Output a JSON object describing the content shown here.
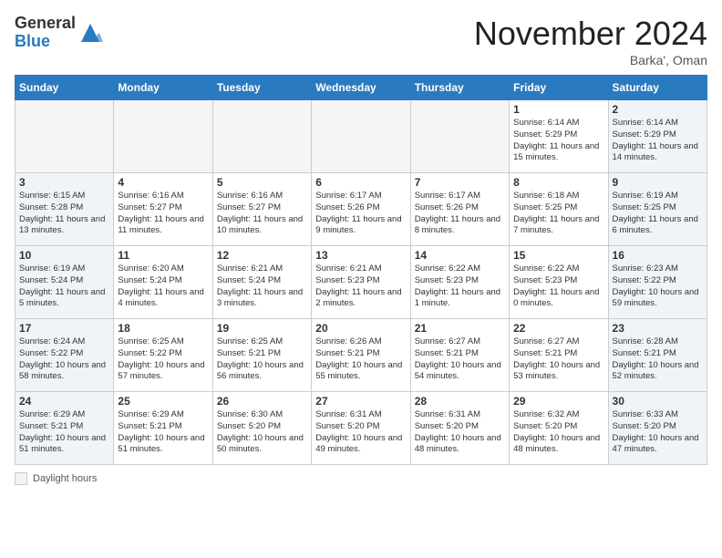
{
  "logo": {
    "general": "General",
    "blue": "Blue"
  },
  "title": "November 2024",
  "location": "Barka', Oman",
  "days_of_week": [
    "Sunday",
    "Monday",
    "Tuesday",
    "Wednesday",
    "Thursday",
    "Friday",
    "Saturday"
  ],
  "legend_label": "Daylight hours",
  "weeks": [
    [
      {
        "day": "",
        "info": ""
      },
      {
        "day": "",
        "info": ""
      },
      {
        "day": "",
        "info": ""
      },
      {
        "day": "",
        "info": ""
      },
      {
        "day": "",
        "info": ""
      },
      {
        "day": "1",
        "info": "Sunrise: 6:14 AM\nSunset: 5:29 PM\nDaylight: 11 hours and 15 minutes."
      },
      {
        "day": "2",
        "info": "Sunrise: 6:14 AM\nSunset: 5:29 PM\nDaylight: 11 hours and 14 minutes."
      }
    ],
    [
      {
        "day": "3",
        "info": "Sunrise: 6:15 AM\nSunset: 5:28 PM\nDaylight: 11 hours and 13 minutes."
      },
      {
        "day": "4",
        "info": "Sunrise: 6:16 AM\nSunset: 5:27 PM\nDaylight: 11 hours and 11 minutes."
      },
      {
        "day": "5",
        "info": "Sunrise: 6:16 AM\nSunset: 5:27 PM\nDaylight: 11 hours and 10 minutes."
      },
      {
        "day": "6",
        "info": "Sunrise: 6:17 AM\nSunset: 5:26 PM\nDaylight: 11 hours and 9 minutes."
      },
      {
        "day": "7",
        "info": "Sunrise: 6:17 AM\nSunset: 5:26 PM\nDaylight: 11 hours and 8 minutes."
      },
      {
        "day": "8",
        "info": "Sunrise: 6:18 AM\nSunset: 5:25 PM\nDaylight: 11 hours and 7 minutes."
      },
      {
        "day": "9",
        "info": "Sunrise: 6:19 AM\nSunset: 5:25 PM\nDaylight: 11 hours and 6 minutes."
      }
    ],
    [
      {
        "day": "10",
        "info": "Sunrise: 6:19 AM\nSunset: 5:24 PM\nDaylight: 11 hours and 5 minutes."
      },
      {
        "day": "11",
        "info": "Sunrise: 6:20 AM\nSunset: 5:24 PM\nDaylight: 11 hours and 4 minutes."
      },
      {
        "day": "12",
        "info": "Sunrise: 6:21 AM\nSunset: 5:24 PM\nDaylight: 11 hours and 3 minutes."
      },
      {
        "day": "13",
        "info": "Sunrise: 6:21 AM\nSunset: 5:23 PM\nDaylight: 11 hours and 2 minutes."
      },
      {
        "day": "14",
        "info": "Sunrise: 6:22 AM\nSunset: 5:23 PM\nDaylight: 11 hours and 1 minute."
      },
      {
        "day": "15",
        "info": "Sunrise: 6:22 AM\nSunset: 5:23 PM\nDaylight: 11 hours and 0 minutes."
      },
      {
        "day": "16",
        "info": "Sunrise: 6:23 AM\nSunset: 5:22 PM\nDaylight: 10 hours and 59 minutes."
      }
    ],
    [
      {
        "day": "17",
        "info": "Sunrise: 6:24 AM\nSunset: 5:22 PM\nDaylight: 10 hours and 58 minutes."
      },
      {
        "day": "18",
        "info": "Sunrise: 6:25 AM\nSunset: 5:22 PM\nDaylight: 10 hours and 57 minutes."
      },
      {
        "day": "19",
        "info": "Sunrise: 6:25 AM\nSunset: 5:21 PM\nDaylight: 10 hours and 56 minutes."
      },
      {
        "day": "20",
        "info": "Sunrise: 6:26 AM\nSunset: 5:21 PM\nDaylight: 10 hours and 55 minutes."
      },
      {
        "day": "21",
        "info": "Sunrise: 6:27 AM\nSunset: 5:21 PM\nDaylight: 10 hours and 54 minutes."
      },
      {
        "day": "22",
        "info": "Sunrise: 6:27 AM\nSunset: 5:21 PM\nDaylight: 10 hours and 53 minutes."
      },
      {
        "day": "23",
        "info": "Sunrise: 6:28 AM\nSunset: 5:21 PM\nDaylight: 10 hours and 52 minutes."
      }
    ],
    [
      {
        "day": "24",
        "info": "Sunrise: 6:29 AM\nSunset: 5:21 PM\nDaylight: 10 hours and 51 minutes."
      },
      {
        "day": "25",
        "info": "Sunrise: 6:29 AM\nSunset: 5:21 PM\nDaylight: 10 hours and 51 minutes."
      },
      {
        "day": "26",
        "info": "Sunrise: 6:30 AM\nSunset: 5:20 PM\nDaylight: 10 hours and 50 minutes."
      },
      {
        "day": "27",
        "info": "Sunrise: 6:31 AM\nSunset: 5:20 PM\nDaylight: 10 hours and 49 minutes."
      },
      {
        "day": "28",
        "info": "Sunrise: 6:31 AM\nSunset: 5:20 PM\nDaylight: 10 hours and 48 minutes."
      },
      {
        "day": "29",
        "info": "Sunrise: 6:32 AM\nSunset: 5:20 PM\nDaylight: 10 hours and 48 minutes."
      },
      {
        "day": "30",
        "info": "Sunrise: 6:33 AM\nSunset: 5:20 PM\nDaylight: 10 hours and 47 minutes."
      }
    ]
  ]
}
